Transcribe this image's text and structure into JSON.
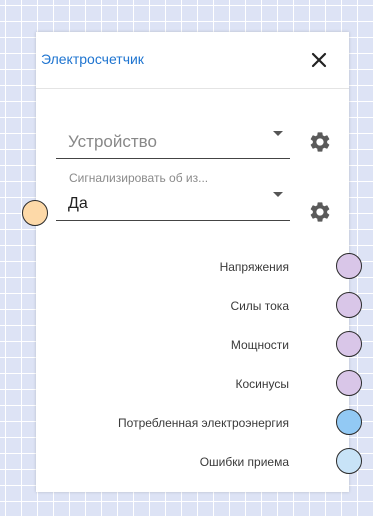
{
  "panel": {
    "title": "Электросчетчик",
    "close_icon": "close-icon"
  },
  "device_select": {
    "placeholder": "Устройство",
    "settings_icon": "gear-icon"
  },
  "alarm_select": {
    "label": "Сигнализировать об из...",
    "value": "Да",
    "settings_icon": "gear-icon"
  },
  "input_port": {
    "color": "#fdd9a8"
  },
  "outputs": [
    {
      "label": "Напряжения",
      "color": "#d9c6e8"
    },
    {
      "label": "Силы тока",
      "color": "#d9c6e8"
    },
    {
      "label": "Мощности",
      "color": "#d9c6e8"
    },
    {
      "label": "Косинусы",
      "color": "#d9c6e8"
    },
    {
      "label": "Потребленная электроэнергия",
      "color": "#92c9f4"
    },
    {
      "label": "Ошибки приема",
      "color": "#c8e3f7"
    }
  ]
}
